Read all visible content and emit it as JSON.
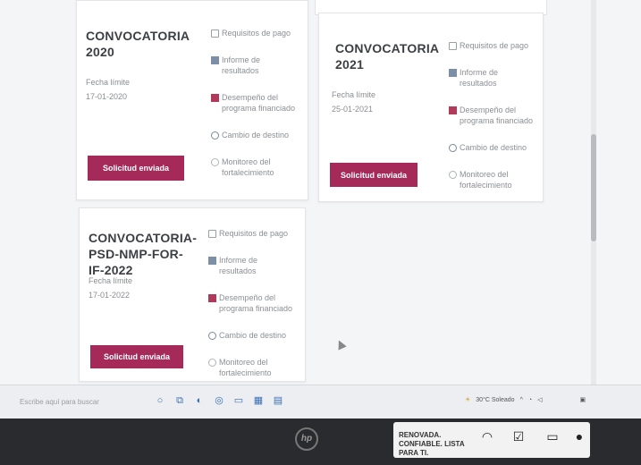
{
  "cards": [
    {
      "title": "CONVOCATORIA 2020",
      "deadline_label": "Fecha límite",
      "deadline_date": "17-01-2020",
      "button": "Solicitud enviada"
    },
    {
      "title": "CONVOCATORIA 2021",
      "deadline_label": "Fecha límite",
      "deadline_date": "25-01-2021",
      "button": "Solicitud enviada"
    },
    {
      "title": "CONVOCATORIA-PSD-NMP-FOR-IF-2022",
      "deadline_label": "Fecha límite",
      "deadline_date": "17-01-2022",
      "button": "Solicitud enviada"
    }
  ],
  "links": {
    "payment": "Requisitos de pago",
    "results": "Informe de resultados",
    "performance": "Desempeño del programa financiado",
    "destination": "Cambio de destino",
    "monitoring": "Monitoreo del fortalecimiento"
  },
  "taskbar": {
    "search_placeholder": "Escribe aquí para buscar",
    "weather": "30°C Soleado"
  },
  "sticker": {
    "text": "RENOVADA. CONFIABLE. LISTA PARA TI."
  },
  "icons": [
    "payment-icon",
    "results-icon",
    "performance-icon",
    "destination-icon",
    "monitoring-icon"
  ],
  "colors": {
    "accent": "#a52a5a"
  }
}
